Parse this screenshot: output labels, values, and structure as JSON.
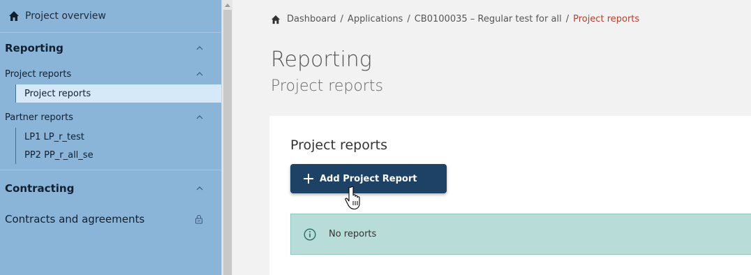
{
  "sidebar": {
    "overview_label": "Project overview",
    "reporting_label": "Reporting",
    "project_reports_group": "Project reports",
    "project_reports_item": "Project reports",
    "partner_reports_group": "Partner reports",
    "partner_items": [
      "LP1 LP_r_test",
      "PP2 PP_r_all_se"
    ],
    "contracting_label": "Contracting",
    "contracts_label": "Contracts and agreements"
  },
  "breadcrumb": {
    "items": [
      "Dashboard",
      "Applications",
      "CB0100035 – Regular test for all"
    ],
    "current": "Project reports",
    "separator": "/"
  },
  "page": {
    "title": "Reporting",
    "subtitle": "Project reports"
  },
  "card": {
    "title": "Project reports",
    "add_button_label": "Add Project Report",
    "alert_text": "No reports"
  },
  "colors": {
    "sidebar_bg": "#8ab4d8",
    "active_item_bg": "#d6e9f9",
    "button_bg": "#1d4266",
    "alert_bg": "#b8dcd8",
    "breadcrumb_current": "#b5412f"
  }
}
